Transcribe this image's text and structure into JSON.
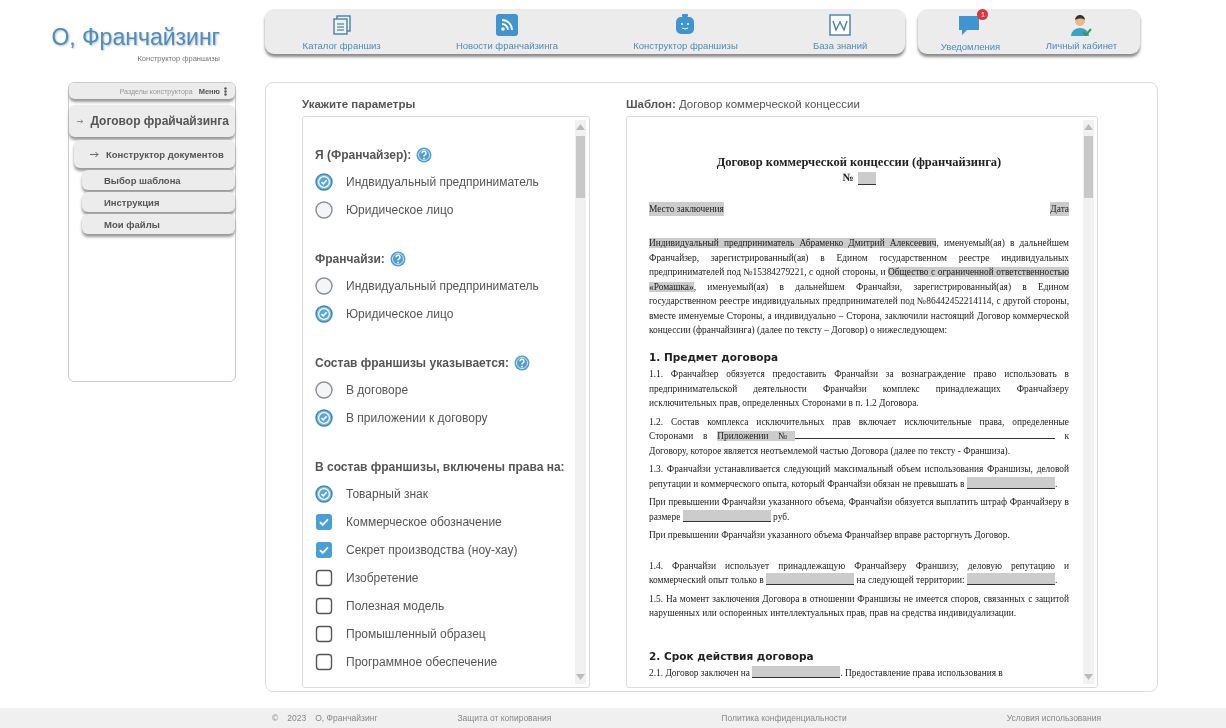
{
  "logo": {
    "title": "О, Франчайзинг",
    "subtitle": "Конструктор франшизы"
  },
  "nav": [
    {
      "label": "Каталог франшиз",
      "kind": "documents"
    },
    {
      "label": "Новости франчайзинга",
      "kind": "rss"
    },
    {
      "label": "Конструктор франшизы",
      "kind": "robot"
    },
    {
      "label": "База знаний",
      "kind": "wiki"
    }
  ],
  "user_nav": [
    {
      "label": "Уведомления",
      "kind": "chat",
      "badge": "1"
    },
    {
      "label": "Личный кабинет",
      "kind": "user"
    }
  ],
  "sidebar": {
    "caption": "Разделы конструктора",
    "menu": "Меню",
    "items": [
      {
        "label": "Договор фрайчайзинга",
        "arrow": true,
        "children": [
          {
            "label": "Конструктор документов",
            "arrow": true,
            "children": [
              {
                "label": "Выбор шаблона",
                "arrow": false
              },
              {
                "label": "Инструкция",
                "arrow": false
              },
              {
                "label": "Мои файлы",
                "arrow": false
              }
            ]
          }
        ]
      }
    ]
  },
  "params": {
    "title": "Укажите параметры",
    "groups": [
      {
        "title": "Я (Франчайзер):",
        "help": true,
        "options": [
          {
            "label": "Индвидуальный предприниматель",
            "kind": "radio",
            "checked": true
          },
          {
            "label": "Юридическое лицо",
            "kind": "radio",
            "checked": false
          }
        ]
      },
      {
        "title": "Франчайзи:",
        "help": true,
        "options": [
          {
            "label": "Индвидуальный предприниматель",
            "kind": "radio",
            "checked": false
          },
          {
            "label": "Юридическое лицо",
            "kind": "radio",
            "checked": true
          }
        ]
      },
      {
        "title": "Состав франшизы указывается:",
        "help": true,
        "options": [
          {
            "label": "В договоре",
            "kind": "radio",
            "checked": false
          },
          {
            "label": "В приложении к договору",
            "kind": "radio",
            "checked": true
          }
        ]
      },
      {
        "title": "В состав франшизы, включены права на:",
        "help": false,
        "options": [
          {
            "label": "Товарный знак",
            "kind": "radio",
            "checked": true
          },
          {
            "label": "Коммерческое обозначение",
            "kind": "checkbox",
            "checked": true
          },
          {
            "label": "Секрет производства (ноу-хау)",
            "kind": "checkbox",
            "checked": true
          },
          {
            "label": "Изобретение",
            "kind": "checkbox",
            "checked": false
          },
          {
            "label": "Полезная модель",
            "kind": "checkbox",
            "checked": false
          },
          {
            "label": "Промышленный образец",
            "kind": "checkbox",
            "checked": false
          },
          {
            "label": "Программное обеспечение",
            "kind": "checkbox",
            "checked": false
          }
        ]
      }
    ]
  },
  "template": {
    "label": "**Шаблон:** Договор коммерческой концессии",
    "document": {
      "title": "Договор коммерческой концессии (франчайзинга)",
      "number_label": "№",
      "place": "Место заключения",
      "date": "Дата",
      "blocks": [
        {
          "kind": "para",
          "segments": [
            {
              "kind": "mark",
              "text": "Индивидуальный предприниматель Абраменко Дмитрий Алексеевич"
            },
            {
              "kind": "text",
              "text": ", именуемый(ая) в дальнейшем Франчайзер, зарегистрированный(ая) в Едином государственном реестре индивидуальных предпринимателей под №15384279221, с одной стороны, и "
            },
            {
              "kind": "mark",
              "text": "Общество с ограниченной ответственностью «Ромашка»"
            },
            {
              "kind": "text",
              "text": ", именуемый(ая) в дальнейшем Франчайзи, зарегистрированный(ая) в Едином государственном реестре индивидуальных предпринимателей под №86442452214114, с другой стороны, вместе именуемые Стороны, а индивидуально – Сторона, заключили настоящий Договор коммерческой концессии (франчайзинга) (далее по тексту – Договор) о нижеследующем:"
            }
          ]
        },
        {
          "kind": "heading",
          "text": "1. Предмет договора"
        },
        {
          "kind": "para",
          "segments": [
            {
              "kind": "text",
              "text": "1.1. Франчайзер обязуется предоставить Франчайзи за вознаграждение право использовать в предпринимательской деятельности Франчайзи комплекс принадлежащих Франчайзеру исключительных прав, определенных Сторонами в п. 1.2 Договора."
            }
          ]
        },
        {
          "kind": "para",
          "segments": [
            {
              "kind": "text",
              "text": "1.2. Состав комплекса исключительных прав включает исключительные права, определенные Сторонами в "
            },
            {
              "kind": "mark",
              "text": "Приложении №"
            },
            {
              "kind": "line"
            },
            {
              "kind": "text",
              "text": " к Договору, которое является неотъемлемой частью Договора (далее по тексту - Франшиза)."
            }
          ]
        },
        {
          "kind": "para",
          "segments": [
            {
              "kind": "text",
              "text": "1.3. Франчайзи устанавливается следующий максимальный объем использования Франшизы, деловой репутации и коммерческого опыта, который Франчайзи обязан не превышать в "
            },
            {
              "kind": "blank"
            },
            {
              "kind": "text",
              "text": "."
            }
          ]
        },
        {
          "kind": "para",
          "segments": [
            {
              "kind": "text",
              "text": "При превышении Франчайзи указанного объема, Франчайзи обязуется выплатить штраф Франчайзеру в размере "
            },
            {
              "kind": "blank"
            },
            {
              "kind": "text",
              "text": " руб."
            }
          ]
        },
        {
          "kind": "para",
          "segments": [
            {
              "kind": "text",
              "text": "При превышении Франчайзи указанного объема Франчайзер вправе расторгнуть Договор."
            }
          ]
        },
        {
          "kind": "gap"
        },
        {
          "kind": "para",
          "segments": [
            {
              "kind": "text",
              "text": "1.4. Франчайзи использует принадлежащую Франчайзеру Франшизу, деловую репутацию и коммерческий опыт только в "
            },
            {
              "kind": "blank"
            },
            {
              "kind": "text",
              "text": " на следующей территории: "
            },
            {
              "kind": "blank"
            },
            {
              "kind": "text",
              "text": "."
            }
          ]
        },
        {
          "kind": "para",
          "segments": [
            {
              "kind": "text",
              "text": "1.5. На момент заключения Договора в отношении Франшизы не имеется споров, связанных с защитой нарушенных или оспоренных интеллектуальных прав, прав на средства индивидуализации."
            }
          ]
        },
        {
          "kind": "gap"
        },
        {
          "kind": "heading",
          "text": "2. Срок действия договора"
        },
        {
          "kind": "para",
          "segments": [
            {
              "kind": "text",
              "text": "2.1. Договор заключен на "
            },
            {
              "kind": "blank"
            },
            {
              "kind": "text",
              "text": ". Предоставление права использования в"
            }
          ]
        }
      ]
    }
  },
  "footer": {
    "copyright": "©",
    "year": "2023",
    "brand": "О, Франчайзинг",
    "links": [
      "Защита от копирования",
      "Политика конфиденциальности",
      "Условия использования"
    ]
  }
}
